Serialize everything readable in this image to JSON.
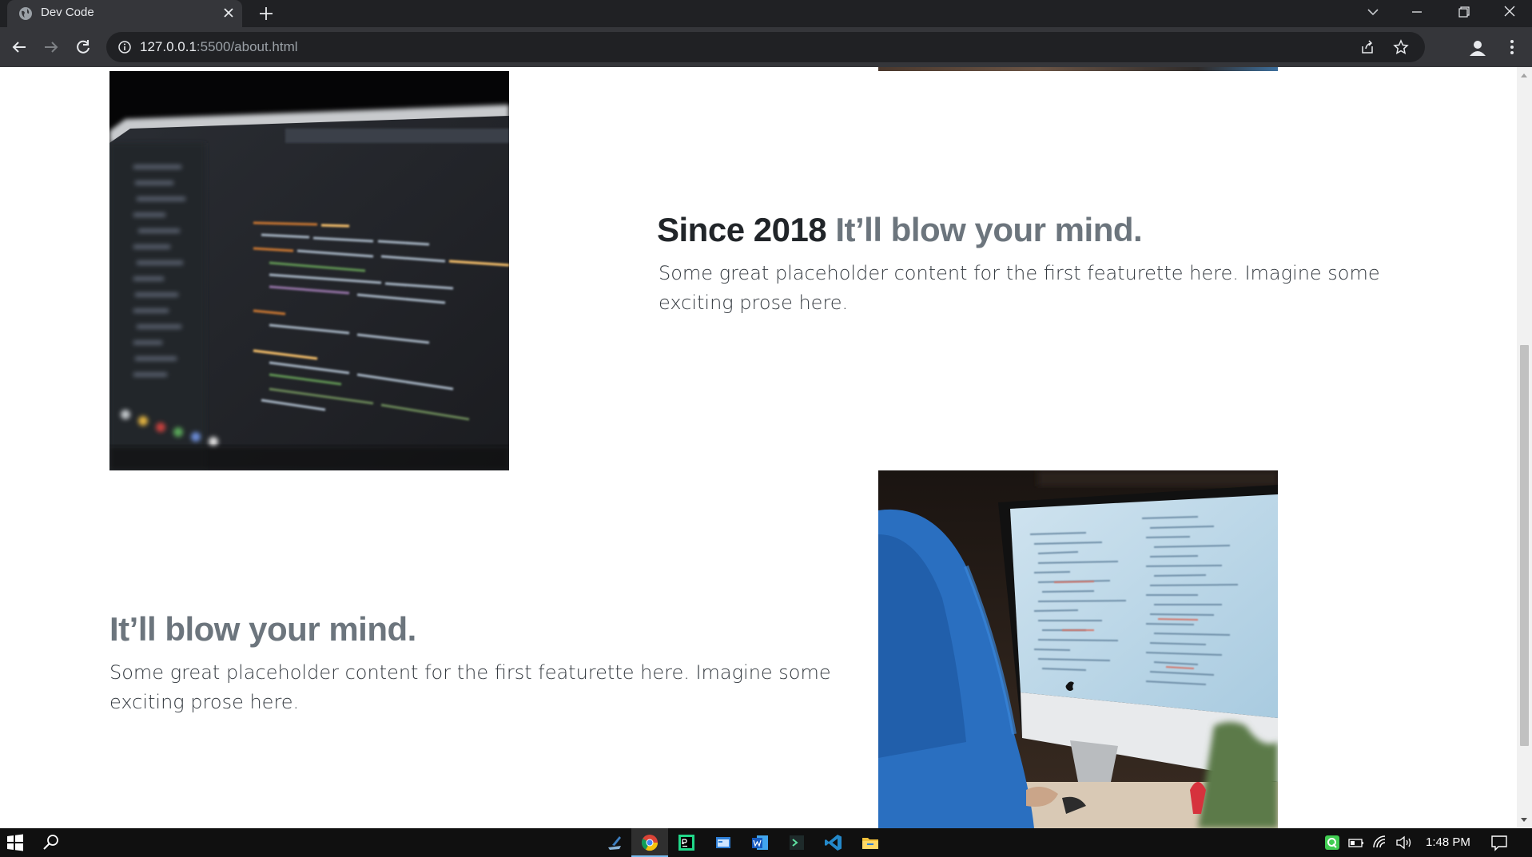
{
  "browser": {
    "tab_title": "Dev Code",
    "url_host": "127.0.0.1",
    "url_rest": ":5500/about.html"
  },
  "featurettes": [
    {
      "heading_main": "Since 2018",
      "heading_muted": "It’ll blow your mind.",
      "text": "Some great placeholder content for the first featurette here. Imagine some exciting prose here."
    },
    {
      "heading_main": "",
      "heading_muted": "It’ll blow your mind.",
      "text": "Some great placeholder content for the first featurette here. Imagine some exciting prose here."
    }
  ],
  "taskbar": {
    "time": "1:48 PM"
  },
  "colors": {
    "heading": "#212529",
    "muted": "#6c757d",
    "chrome_dark": "#202124",
    "chrome_toolbar": "#35363a",
    "taskbar": "#101010"
  }
}
